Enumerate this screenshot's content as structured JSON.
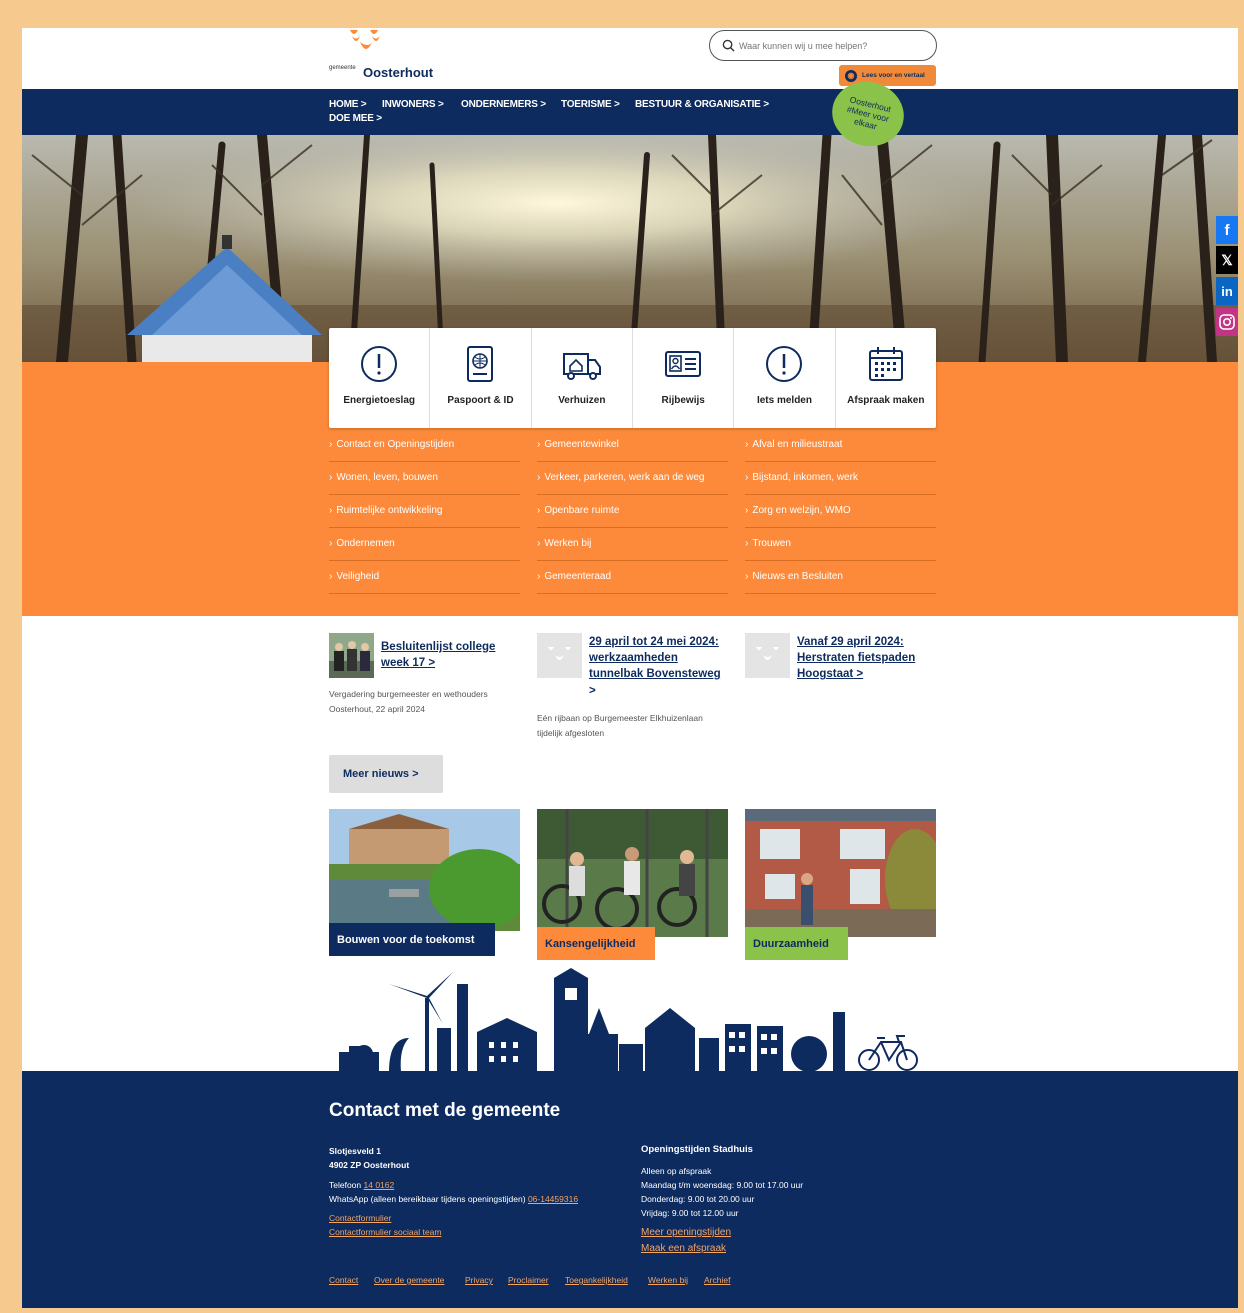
{
  "header": {
    "logo_small": "gemeente",
    "logo_name": "Oosterhout",
    "search_placeholder": "Waar kunnen wij u mee helpen?",
    "readspeaker_label": "Lees voor en vertaal"
  },
  "nav": {
    "items": [
      "HOME >",
      "INWONERS >",
      "ONDERNEMERS >",
      "TOERISME >",
      "BESTUUR & ORGANISATIE >",
      "DOE MEE >"
    ],
    "badge": "Oosterhout #Meer voor elkaar"
  },
  "social": [
    "facebook-icon",
    "x-icon",
    "linkedin-icon",
    "instagram-icon"
  ],
  "tiles": [
    {
      "label": "Energietoeslag",
      "icon": "alert-icon"
    },
    {
      "label": "Paspoort & ID",
      "icon": "passport-icon"
    },
    {
      "label": "Verhuizen",
      "icon": "moving-truck-icon"
    },
    {
      "label": "Rijbewijs",
      "icon": "drivers-license-icon"
    },
    {
      "label": "Iets melden",
      "icon": "alert-icon"
    },
    {
      "label": "Afspraak maken",
      "icon": "calendar-icon"
    }
  ],
  "links": {
    "col1": [
      "Contact en Openingstijden",
      "Wonen, leven, bouwen",
      "Ruimtelijke ontwikkeling",
      "Ondernemen",
      "Veiligheid"
    ],
    "col2": [
      "Gemeentewinkel",
      "Verkeer, parkeren, werk aan de weg",
      "Openbare ruimte",
      "Werken bij",
      "Gemeenteraad"
    ],
    "col3": [
      "Afval en milieustraat",
      "Bijstand, inkomen, werk",
      "Zorg en welzijn, WMO",
      "Trouwen",
      "Nieuws en Besluiten"
    ]
  },
  "news": [
    {
      "title_l1": "Besluitenlijst college",
      "title_l2": "week 17 >",
      "title_l3": "",
      "title_l4": "",
      "desc_l1": "Vergadering burgemeester en wethouders",
      "desc_l2": "Oosterhout, 22 april 2024"
    },
    {
      "title_l1": "29 april tot 24 mei 2024:",
      "title_l2": "werkzaamheden",
      "title_l3": "tunnelbak Bovensteweg",
      "title_l4": ">",
      "desc_l1": "Eén rijbaan op Burgemeester Elkhuizenlaan",
      "desc_l2": "tijdelijk afgesloten"
    },
    {
      "title_l1": "Vanaf 29 april 2024:",
      "title_l2": "Herstraten fietspaden",
      "title_l3": "Hoogstaat >",
      "title_l4": "",
      "desc_l1": "",
      "desc_l2": ""
    }
  ],
  "more_news": "Meer nieuws >",
  "cards": [
    {
      "label": "Bouwen voor de toekomst",
      "color": "#0d2b5e"
    },
    {
      "label": "Kansengelijkheid",
      "color": "#fd8a3a"
    },
    {
      "label": "Duurzaamheid",
      "color": "#8bc34a"
    }
  ],
  "footer": {
    "heading": "Contact met de gemeente",
    "address_l1": "Slotjesveld 1",
    "address_l2": "4902 ZP Oosterhout",
    "phone_label": "Telefoon",
    "phone_number": "14 0162",
    "whatsapp_label": "WhatsApp (alleen bereikbaar tijdens openingstijden)",
    "whatsapp_number": "06-14459316",
    "contact_form": "Contactformulier",
    "contact_form_social": "Contactformulier sociaal team",
    "hours_title": "Openingstijden Stadhuis",
    "hours": [
      "Alleen op afspraak",
      "Maandag t/m woensdag: 9.00 tot 17.00 uur",
      "Donderdag: 9.00 tot 20.00 uur",
      "Vrijdag: 9.00 tot 12.00 uur"
    ],
    "more_hours": "Meer openingstijden",
    "make_appointment": "Maak een afspraak",
    "bottom_links": [
      "Contact",
      "Over de gemeente",
      "Privacy",
      "Proclaimer",
      "Toegankelijkheid",
      "Werken bij",
      "Archief"
    ]
  }
}
